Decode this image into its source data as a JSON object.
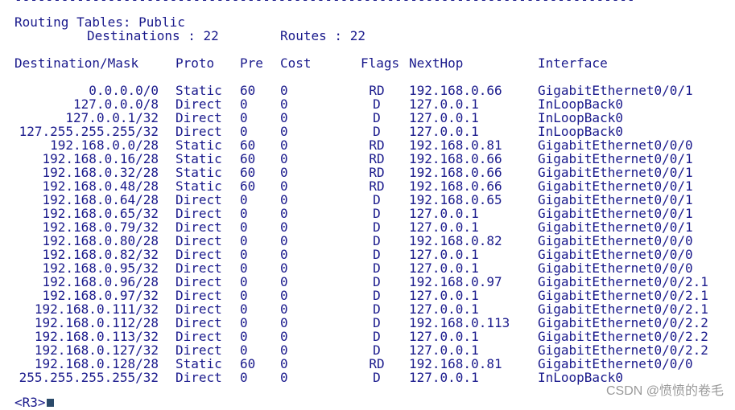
{
  "top_fragment": "--------------------------------------------------------------------------------",
  "routing": {
    "title": "Routing Tables: Public",
    "destinations_label": "Destinations : 22",
    "routes_label": "Routes : 22"
  },
  "headers": {
    "destination": "Destination/Mask",
    "proto": "Proto",
    "pre": "Pre",
    "cost": "Cost",
    "flags": "Flags",
    "nexthop": "NextHop",
    "interface": "Interface"
  },
  "routes": [
    {
      "dest": "0.0.0.0/0",
      "proto": "Static",
      "pre": "60",
      "cost": "0",
      "flags": "RD",
      "nexthop": "192.168.0.66",
      "iface": "GigabitEthernet0/0/1"
    },
    {
      "dest": "127.0.0.0/8",
      "proto": "Direct",
      "pre": "0",
      "cost": "0",
      "flags": "D",
      "nexthop": "127.0.0.1",
      "iface": "InLoopBack0"
    },
    {
      "dest": "127.0.0.1/32",
      "proto": "Direct",
      "pre": "0",
      "cost": "0",
      "flags": "D",
      "nexthop": "127.0.0.1",
      "iface": "InLoopBack0"
    },
    {
      "dest": "127.255.255.255/32",
      "proto": "Direct",
      "pre": "0",
      "cost": "0",
      "flags": "D",
      "nexthop": "127.0.0.1",
      "iface": "InLoopBack0"
    },
    {
      "dest": "192.168.0.0/28",
      "proto": "Static",
      "pre": "60",
      "cost": "0",
      "flags": "RD",
      "nexthop": "192.168.0.81",
      "iface": "GigabitEthernet0/0/0"
    },
    {
      "dest": "192.168.0.16/28",
      "proto": "Static",
      "pre": "60",
      "cost": "0",
      "flags": "RD",
      "nexthop": "192.168.0.66",
      "iface": "GigabitEthernet0/0/1"
    },
    {
      "dest": "192.168.0.32/28",
      "proto": "Static",
      "pre": "60",
      "cost": "0",
      "flags": "RD",
      "nexthop": "192.168.0.66",
      "iface": "GigabitEthernet0/0/1"
    },
    {
      "dest": "192.168.0.48/28",
      "proto": "Static",
      "pre": "60",
      "cost": "0",
      "flags": "RD",
      "nexthop": "192.168.0.66",
      "iface": "GigabitEthernet0/0/1"
    },
    {
      "dest": "192.168.0.64/28",
      "proto": "Direct",
      "pre": "0",
      "cost": "0",
      "flags": "D",
      "nexthop": "192.168.0.65",
      "iface": "GigabitEthernet0/0/1"
    },
    {
      "dest": "192.168.0.65/32",
      "proto": "Direct",
      "pre": "0",
      "cost": "0",
      "flags": "D",
      "nexthop": "127.0.0.1",
      "iface": "GigabitEthernet0/0/1"
    },
    {
      "dest": "192.168.0.79/32",
      "proto": "Direct",
      "pre": "0",
      "cost": "0",
      "flags": "D",
      "nexthop": "127.0.0.1",
      "iface": "GigabitEthernet0/0/1"
    },
    {
      "dest": "192.168.0.80/28",
      "proto": "Direct",
      "pre": "0",
      "cost": "0",
      "flags": "D",
      "nexthop": "192.168.0.82",
      "iface": "GigabitEthernet0/0/0"
    },
    {
      "dest": "192.168.0.82/32",
      "proto": "Direct",
      "pre": "0",
      "cost": "0",
      "flags": "D",
      "nexthop": "127.0.0.1",
      "iface": "GigabitEthernet0/0/0"
    },
    {
      "dest": "192.168.0.95/32",
      "proto": "Direct",
      "pre": "0",
      "cost": "0",
      "flags": "D",
      "nexthop": "127.0.0.1",
      "iface": "GigabitEthernet0/0/0"
    },
    {
      "dest": "192.168.0.96/28",
      "proto": "Direct",
      "pre": "0",
      "cost": "0",
      "flags": "D",
      "nexthop": "192.168.0.97",
      "iface": "GigabitEthernet0/0/2.1"
    },
    {
      "dest": "192.168.0.97/32",
      "proto": "Direct",
      "pre": "0",
      "cost": "0",
      "flags": "D",
      "nexthop": "127.0.0.1",
      "iface": "GigabitEthernet0/0/2.1"
    },
    {
      "dest": "192.168.0.111/32",
      "proto": "Direct",
      "pre": "0",
      "cost": "0",
      "flags": "D",
      "nexthop": "127.0.0.1",
      "iface": "GigabitEthernet0/0/2.1"
    },
    {
      "dest": "192.168.0.112/28",
      "proto": "Direct",
      "pre": "0",
      "cost": "0",
      "flags": "D",
      "nexthop": "192.168.0.113",
      "iface": "GigabitEthernet0/0/2.2"
    },
    {
      "dest": "192.168.0.113/32",
      "proto": "Direct",
      "pre": "0",
      "cost": "0",
      "flags": "D",
      "nexthop": "127.0.0.1",
      "iface": "GigabitEthernet0/0/2.2"
    },
    {
      "dest": "192.168.0.127/32",
      "proto": "Direct",
      "pre": "0",
      "cost": "0",
      "flags": "D",
      "nexthop": "127.0.0.1",
      "iface": "GigabitEthernet0/0/2.2"
    },
    {
      "dest": "192.168.0.128/28",
      "proto": "Static",
      "pre": "60",
      "cost": "0",
      "flags": "RD",
      "nexthop": "192.168.0.81",
      "iface": "GigabitEthernet0/0/0"
    },
    {
      "dest": "255.255.255.255/32",
      "proto": "Direct",
      "pre": "0",
      "cost": "0",
      "flags": "D",
      "nexthop": "127.0.0.1",
      "iface": "InLoopBack0"
    }
  ],
  "prompt": "<R3>",
  "watermark": "CSDN @愤愤的卷毛",
  "colors": {
    "text": "#1a1a8c",
    "background": "#ffffff",
    "cursor": "#2a4a6a",
    "watermark": "#9a9a9a"
  }
}
